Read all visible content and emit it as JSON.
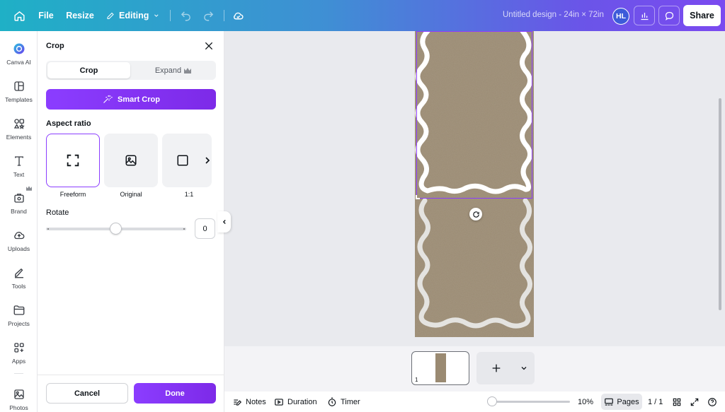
{
  "topbar": {
    "home_icon": "home-icon",
    "file_label": "File",
    "resize_label": "Resize",
    "editing_label": "Editing",
    "design_title": "Untitled design - 24in × 72in",
    "avatar_initials": "HL",
    "share_label": "Share"
  },
  "rail": {
    "items": [
      {
        "label": "Canva AI",
        "icon": "canva-ai-icon"
      },
      {
        "label": "Templates",
        "icon": "templates-icon"
      },
      {
        "label": "Elements",
        "icon": "elements-icon"
      },
      {
        "label": "Text",
        "icon": "text-icon"
      },
      {
        "label": "Brand",
        "icon": "brand-icon"
      },
      {
        "label": "Uploads",
        "icon": "uploads-icon"
      },
      {
        "label": "Tools",
        "icon": "tools-icon"
      },
      {
        "label": "Projects",
        "icon": "projects-icon"
      },
      {
        "label": "Apps",
        "icon": "apps-icon"
      },
      {
        "label": "Photos",
        "icon": "photos-icon"
      }
    ]
  },
  "crop_panel": {
    "title": "Crop",
    "tabs": [
      {
        "label": "Crop",
        "active": true
      },
      {
        "label": "Expand",
        "active": false
      }
    ],
    "smart_crop_label": "Smart Crop",
    "aspect_ratio_label": "Aspect ratio",
    "ratios": [
      {
        "label": "Freeform",
        "selected": true
      },
      {
        "label": "Original",
        "selected": false
      },
      {
        "label": "1:1",
        "selected": false
      }
    ],
    "rotate_label": "Rotate",
    "rotate_value": "0",
    "rotate_fraction": 0.5,
    "cancel_label": "Cancel",
    "done_label": "Done"
  },
  "canvas": {
    "page_color": "#9a8a72",
    "frame_color": "#ffffff",
    "selection_color": "#8b3dff"
  },
  "pages_strip": {
    "thumb_number": "1"
  },
  "bottombar": {
    "notes_label": "Notes",
    "duration_label": "Duration",
    "timer_label": "Timer",
    "zoom_label": "10%",
    "pages_label": "Pages",
    "page_count": "1 / 1"
  },
  "colors": {
    "accent": "#8b3dff",
    "topbar_gradient_start": "#1fb0c6",
    "topbar_gradient_end": "#7b4af0"
  }
}
